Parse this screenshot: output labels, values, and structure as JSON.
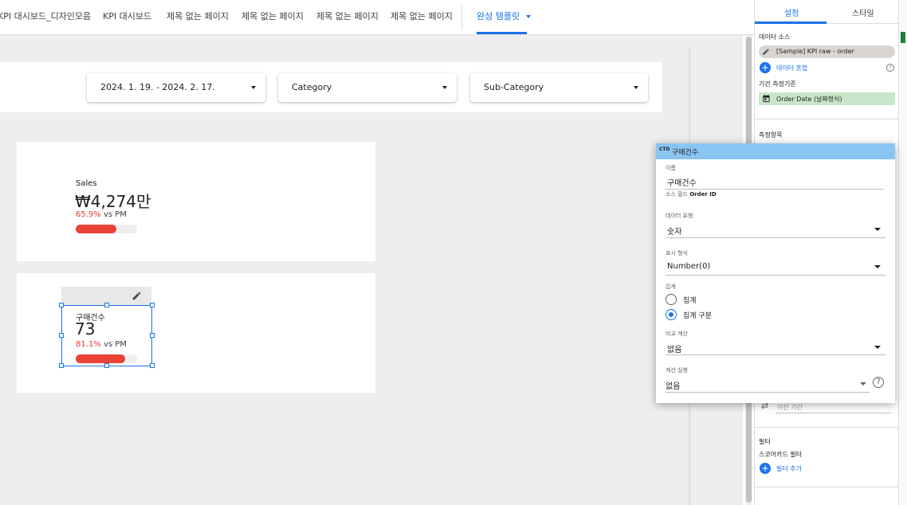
{
  "page_tabs": [
    {
      "label": "KPI 대시보드_디자인모음"
    },
    {
      "label": "KPI 대시보드"
    },
    {
      "label": "제목 없는 페이지"
    },
    {
      "label": "제목 없는 페이지"
    },
    {
      "label": "제목 없는 페이지"
    },
    {
      "label": "제목 없는 페이지"
    },
    {
      "label": "완성 템플릿",
      "active": true
    }
  ],
  "filters": {
    "date_range": "2024. 1. 19. - 2024. 2. 17.",
    "category": "Category",
    "sub_category": "Sub-Category"
  },
  "scorecards": [
    {
      "label": "Sales",
      "value": "₩4,274만",
      "change_pct": "65.9%",
      "change_suffix": "vs PM",
      "progress": 0.659
    },
    {
      "label": "구매건수",
      "value": "73",
      "change_pct": "81.1%",
      "change_suffix": "vs PM",
      "progress": 0.811
    }
  ],
  "panel": {
    "tabs": [
      {
        "label": "설정",
        "active": true
      },
      {
        "label": "스타일"
      }
    ],
    "data_source_title": "데이터 소스",
    "data_source_name": "[Sample] KPI raw - order",
    "blend_label": "데이터 혼합",
    "date_range_dim_title": "기간 측정기준",
    "date_dimension": "Order Date (날짜형식)",
    "metric_title": "측정항목",
    "comparison_value": "이전 기간",
    "filter_title": "필터",
    "scorecard_filter_label": "스코어카드 필터",
    "add_filter_label": "필터 추가"
  },
  "popup": {
    "badge": "CTD",
    "title": "구매건수",
    "name_label": "이름",
    "name_value": "구매건수",
    "source_field_prefix": "소스 필드",
    "source_field_value": "Order ID",
    "data_type_label": "데이터 유형",
    "data_type_value": "숫자",
    "display_format_label": "표시 형식",
    "display_format_value": "Number(0)",
    "aggregation_label": "집계",
    "radio_aggregate": "집계",
    "radio_aggregate_distinct": "집계 구분",
    "selected_radio": "집계 구분",
    "comparison_calc_label": "비교 계산",
    "comparison_calc_value": "없음",
    "running_calc_label": "계산 실행",
    "running_calc_value": "없음"
  },
  "colors": {
    "accent": "#1a73e8",
    "negative": "#ea4335",
    "popup_header": "#8ac4f2",
    "chip_grey": "#d9d6d2",
    "chip_green": "#c8e6c9",
    "canvas_bg": "#eeeeee"
  }
}
